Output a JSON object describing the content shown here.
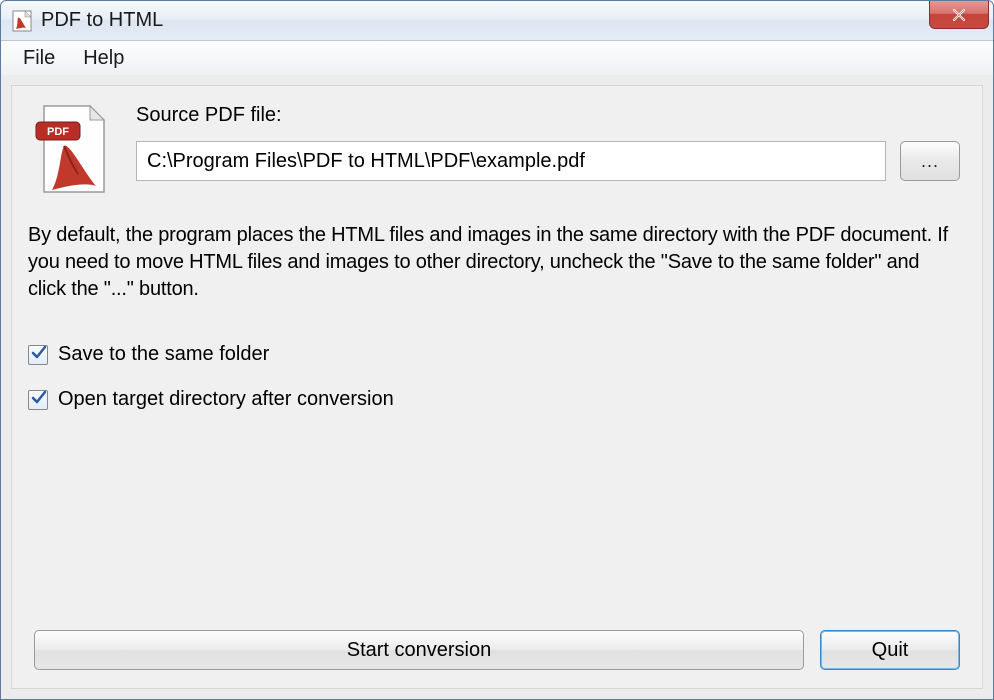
{
  "window": {
    "title": "PDF to HTML"
  },
  "menu": {
    "file": "File",
    "help": "Help"
  },
  "main": {
    "source_label": "Source PDF file:",
    "source_value": "C:\\Program Files\\PDF to HTML\\PDF\\example.pdf",
    "browse_label": "...",
    "description": "By default, the program places the HTML files and images in the same directory with the PDF document. If you need to move HTML files and images to other directory, uncheck the \"Save to the same folder\" and click the \"...\" button.",
    "checkbox_same_folder": "Save to the same folder",
    "checkbox_open_target": "Open target directory after conversion",
    "checkbox_same_folder_checked": true,
    "checkbox_open_target_checked": true
  },
  "buttons": {
    "start": "Start conversion",
    "quit": "Quit"
  }
}
